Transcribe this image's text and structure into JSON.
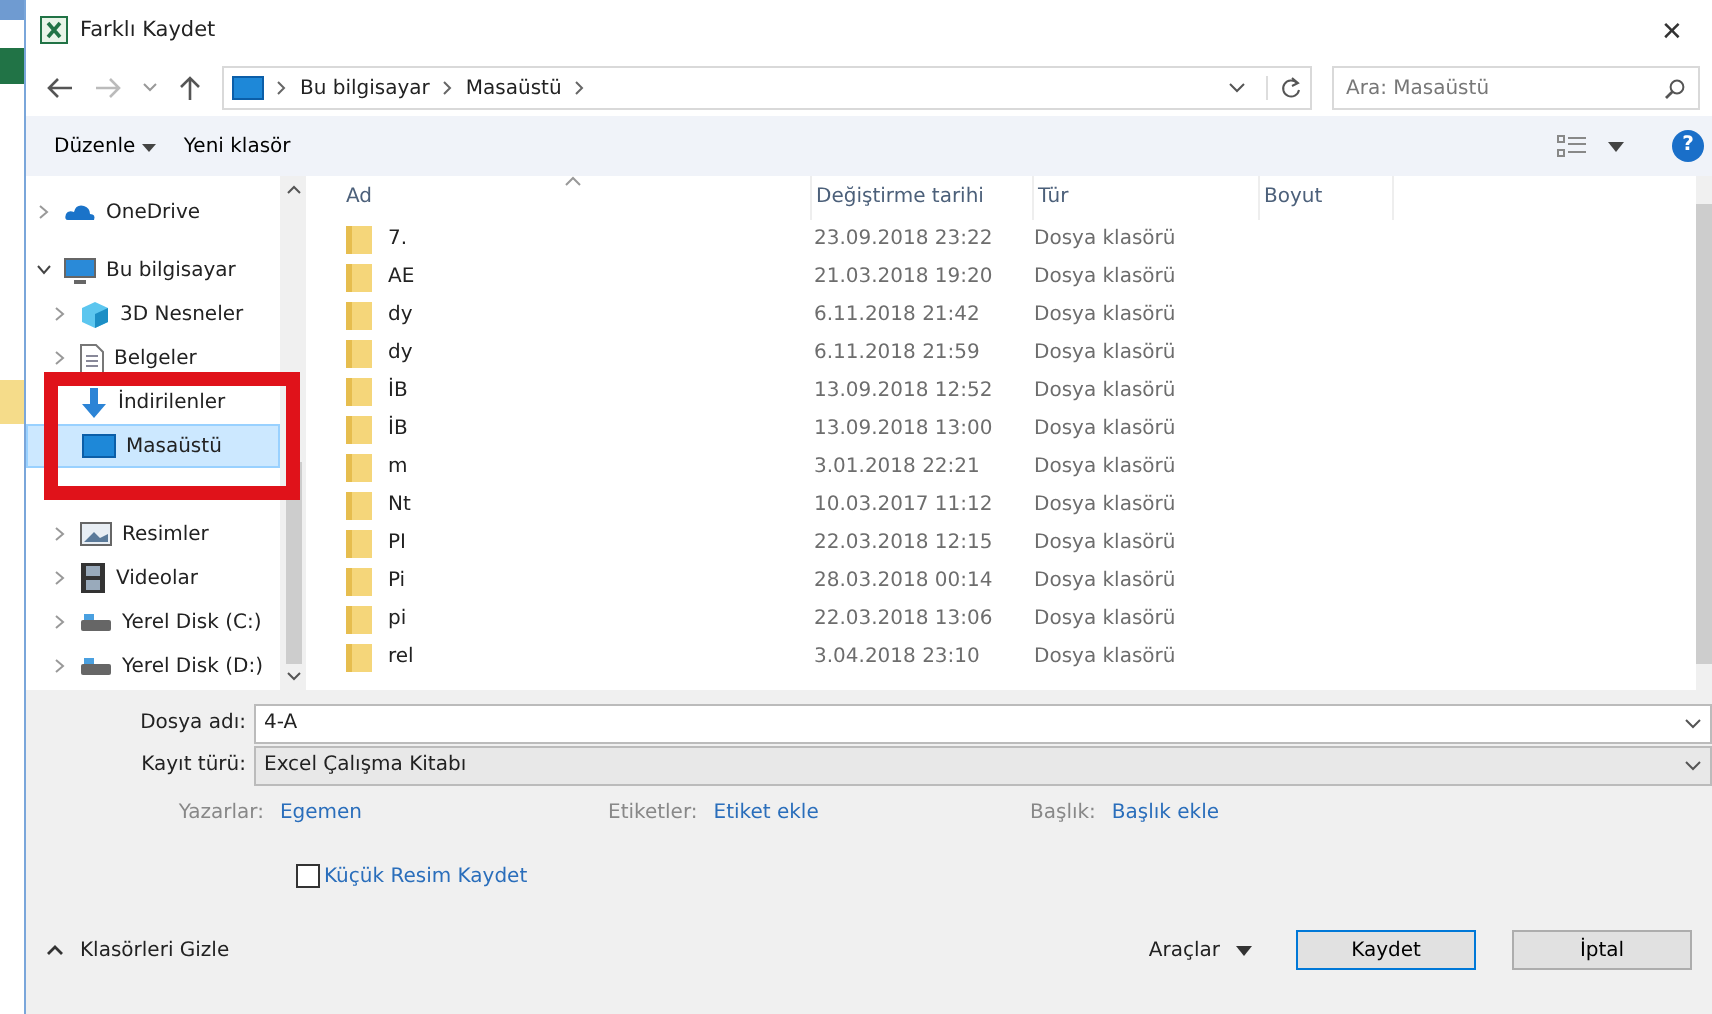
{
  "window": {
    "title": "Farklı Kaydet",
    "close": "✕"
  },
  "address": {
    "path": [
      "Bu bilgisayar",
      "Masaüstü"
    ],
    "search_placeholder": "Ara: Masaüstü"
  },
  "toolbar": {
    "organize": "Düzenle",
    "new_folder": "Yeni klasör",
    "help": "?"
  },
  "sidebar": {
    "items": [
      {
        "label": "OneDrive",
        "expanded": false,
        "selected": false
      },
      {
        "label": "Bu bilgisayar",
        "expanded": true,
        "selected": false,
        "children": [
          {
            "label": "3D Nesneler",
            "expanded": false,
            "selected": false
          },
          {
            "label": "Belgeler",
            "expanded": false,
            "selected": false
          },
          {
            "label": "İndirilenler",
            "selected": false
          },
          {
            "label": "Masaüstü",
            "selected": true
          },
          {
            "selected": false
          },
          {
            "label": "Resimler",
            "expanded": false,
            "selected": false
          },
          {
            "label": "Videolar",
            "expanded": false,
            "selected": false
          },
          {
            "label": "Yerel Disk (C:)",
            "expanded": false,
            "selected": false
          },
          {
            "label": "Yerel Disk (D:)",
            "expanded": false,
            "selected": false
          }
        ]
      }
    ]
  },
  "table": {
    "columns": [
      "Ad",
      "Değiştirme tarihi",
      "Tür",
      "Boyut"
    ],
    "rows": [
      {
        "name": "7.",
        "date": "23.09.2018 23:22",
        "type": "Dosya klasörü"
      },
      {
        "name": "AE",
        "date": "21.03.2018 19:20",
        "type": "Dosya klasörü"
      },
      {
        "name": "dy",
        "date": "6.11.2018 21:42",
        "type": "Dosya klasörü"
      },
      {
        "name": "dy",
        "date": "6.11.2018 21:59",
        "type": "Dosya klasörü"
      },
      {
        "name": "İB",
        "date": "13.09.2018 12:52",
        "type": "Dosya klasörü"
      },
      {
        "name": "İB",
        "date": "13.09.2018 13:00",
        "type": "Dosya klasörü"
      },
      {
        "name": "m",
        "date": "3.01.2018 22:21",
        "type": "Dosya klasörü"
      },
      {
        "name": "Nt",
        "date": "10.03.2017 11:12",
        "type": "Dosya klasörü"
      },
      {
        "name": "PI",
        "date": "22.03.2018 12:15",
        "type": "Dosya klasörü"
      },
      {
        "name": "Pi",
        "date": "28.03.2018 00:14",
        "type": "Dosya klasörü"
      },
      {
        "name": "pi",
        "date": "22.03.2018 13:06",
        "type": "Dosya klasörü"
      },
      {
        "name": "rel",
        "date": "3.04.2018 23:10",
        "type": "Dosya klasörü"
      }
    ]
  },
  "form": {
    "file_name_label": "Dosya adı:",
    "file_name": "4-A",
    "type_label": "Kayıt türü:",
    "type": "Excel Çalışma Kitabı",
    "meta": [
      {
        "label": "Yazarlar:",
        "value": "Egemen"
      },
      {
        "label": "Etiketler:",
        "value": "Etiket ekle"
      },
      {
        "label": "Başlık:",
        "value": "Başlık ekle"
      }
    ],
    "thumbnail": {
      "label": "Küçük Resim Kaydet",
      "checked": false
    }
  },
  "footer": {
    "hide_folders": "Klasörleri Gizle",
    "tools": "Araçlar",
    "save": "Kaydet",
    "cancel": "İptal"
  }
}
